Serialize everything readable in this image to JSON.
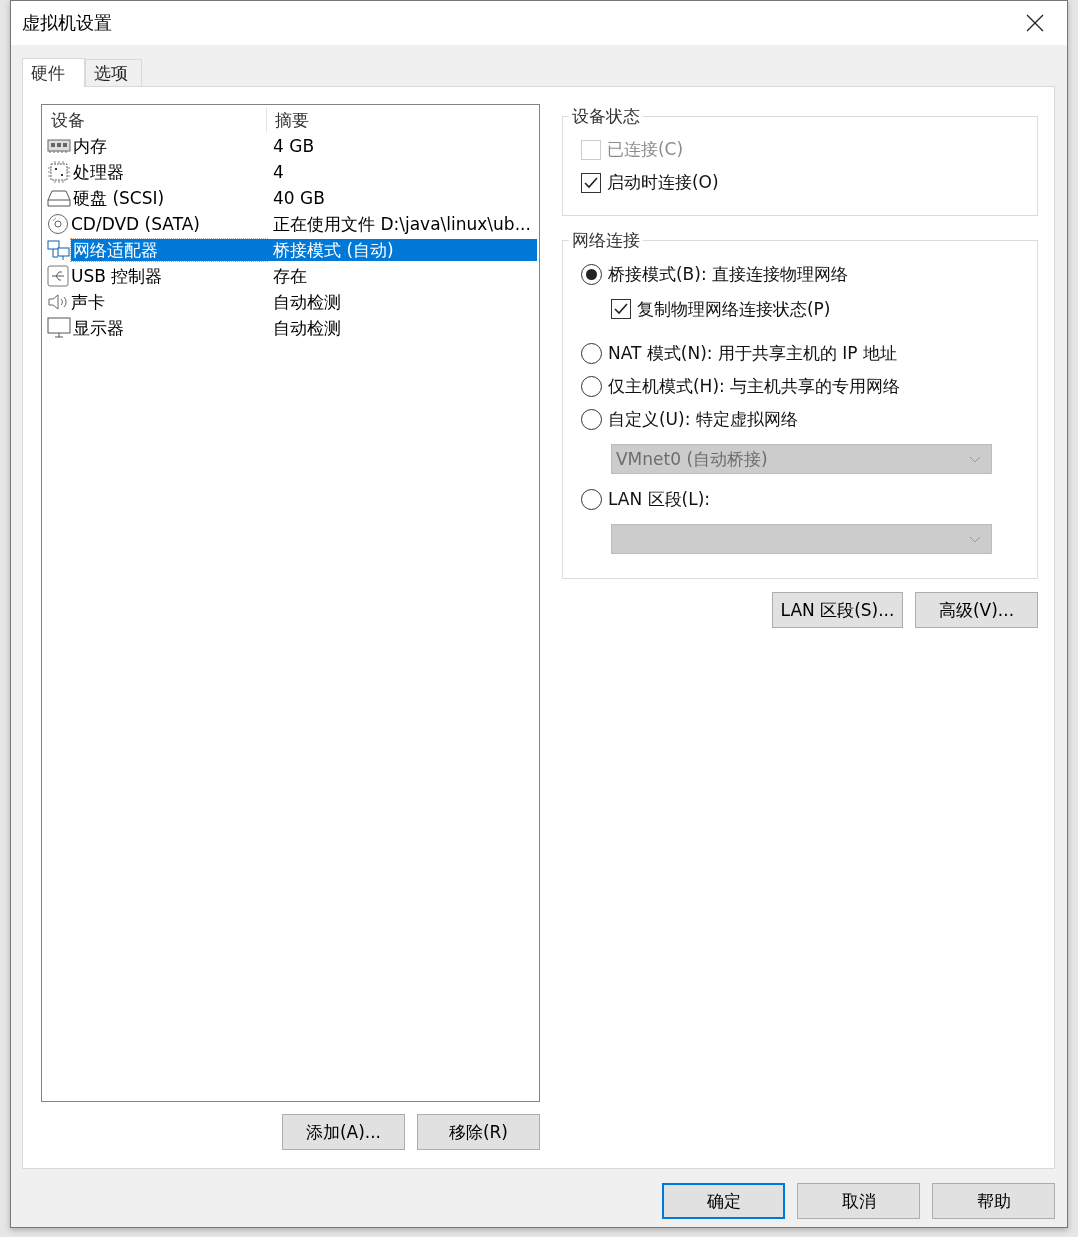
{
  "window": {
    "title": "虚拟机设置"
  },
  "tabs": [
    {
      "label": "硬件",
      "selected": true
    },
    {
      "label": "选项",
      "selected": false
    }
  ],
  "device_list": {
    "columns": [
      "设备",
      "摘要"
    ],
    "rows": [
      {
        "device": "内存",
        "summary": "4 GB",
        "selected": false
      },
      {
        "device": "处理器",
        "summary": "4",
        "selected": false
      },
      {
        "device": "硬盘 (SCSI)",
        "summary": "40 GB",
        "selected": false
      },
      {
        "device": "CD/DVD (SATA)",
        "summary": "正在使用文件 D:\\java\\linux\\ub...",
        "selected": false
      },
      {
        "device": "网络适配器",
        "summary": "桥接模式 (自动)",
        "selected": true
      },
      {
        "device": "USB 控制器",
        "summary": "存在",
        "selected": false
      },
      {
        "device": "声卡",
        "summary": "自动检测",
        "selected": false
      },
      {
        "device": "显示器",
        "summary": "自动检测",
        "selected": false
      }
    ]
  },
  "list_buttons": [
    "添加(A)...",
    "移除(R)"
  ],
  "device_status": {
    "title": "设备状态",
    "options": [
      {
        "label": "已连接(C)",
        "checked": false,
        "disabled": true
      },
      {
        "label": "启动时连接(O)",
        "checked": true,
        "disabled": false
      }
    ]
  },
  "network_connection": {
    "title": "网络连接",
    "items": [
      {
        "kind": "radio",
        "label": "桥接模式(B): 直接连接物理网络",
        "selected": true
      },
      {
        "kind": "checkbox",
        "label": "复制物理网络连接状态(P)",
        "checked": true
      },
      {
        "kind": "radio",
        "label": "NAT 模式(N): 用于共享主机的 IP 地址",
        "selected": false
      },
      {
        "kind": "radio",
        "label": "仅主机模式(H): 与主机共享的专用网络",
        "selected": false
      },
      {
        "kind": "radio",
        "label": "自定义(U): 特定虚拟网络",
        "selected": false
      },
      {
        "kind": "dropdown",
        "value": "VMnet0 (自动桥接)",
        "disabled": true
      },
      {
        "kind": "radio",
        "label": "LAN 区段(L):",
        "selected": false
      },
      {
        "kind": "dropdown",
        "disabled": true
      }
    ]
  },
  "network_buttons": [
    "LAN 区段(S)...",
    "高级(V)..."
  ],
  "dialog_buttons": [
    {
      "label": "确定",
      "default": true
    },
    {
      "label": "取消",
      "default": false
    },
    {
      "label": "帮助",
      "default": false
    }
  ]
}
